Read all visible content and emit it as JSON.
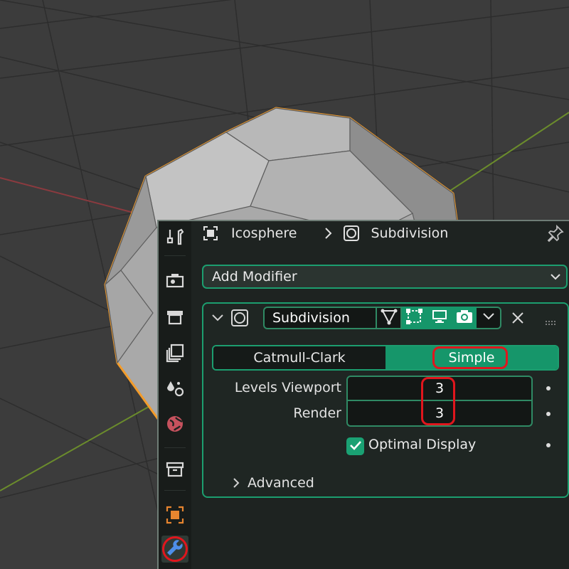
{
  "header": {
    "object_name": "Icosphere",
    "modifier_name": "Subdivision"
  },
  "add_modifier": {
    "label": "Add Modifier"
  },
  "modifier": {
    "name": "Subdivision",
    "modes": [
      "Catmull-Clark",
      "Simple"
    ],
    "active_mode": "Simple",
    "properties": [
      {
        "label": "Levels Viewport",
        "value": "3"
      },
      {
        "label": "Render",
        "value": "3"
      }
    ],
    "optimal_display": {
      "label": "Optimal Display",
      "checked": true
    },
    "advanced": {
      "label": "Advanced"
    }
  },
  "sidebar": {
    "tabs": [
      "tool-icon",
      "render-icon",
      "output-icon",
      "view-layer-icon",
      "scene-icon",
      "world-icon",
      "collection-icon",
      "object-icon",
      "modifier-icon"
    ],
    "active_tab": "modifier-icon"
  },
  "colors": {
    "accent": "#1c9e6f",
    "selection_outline": "#f39c2b",
    "highlight": "#e0161d"
  }
}
